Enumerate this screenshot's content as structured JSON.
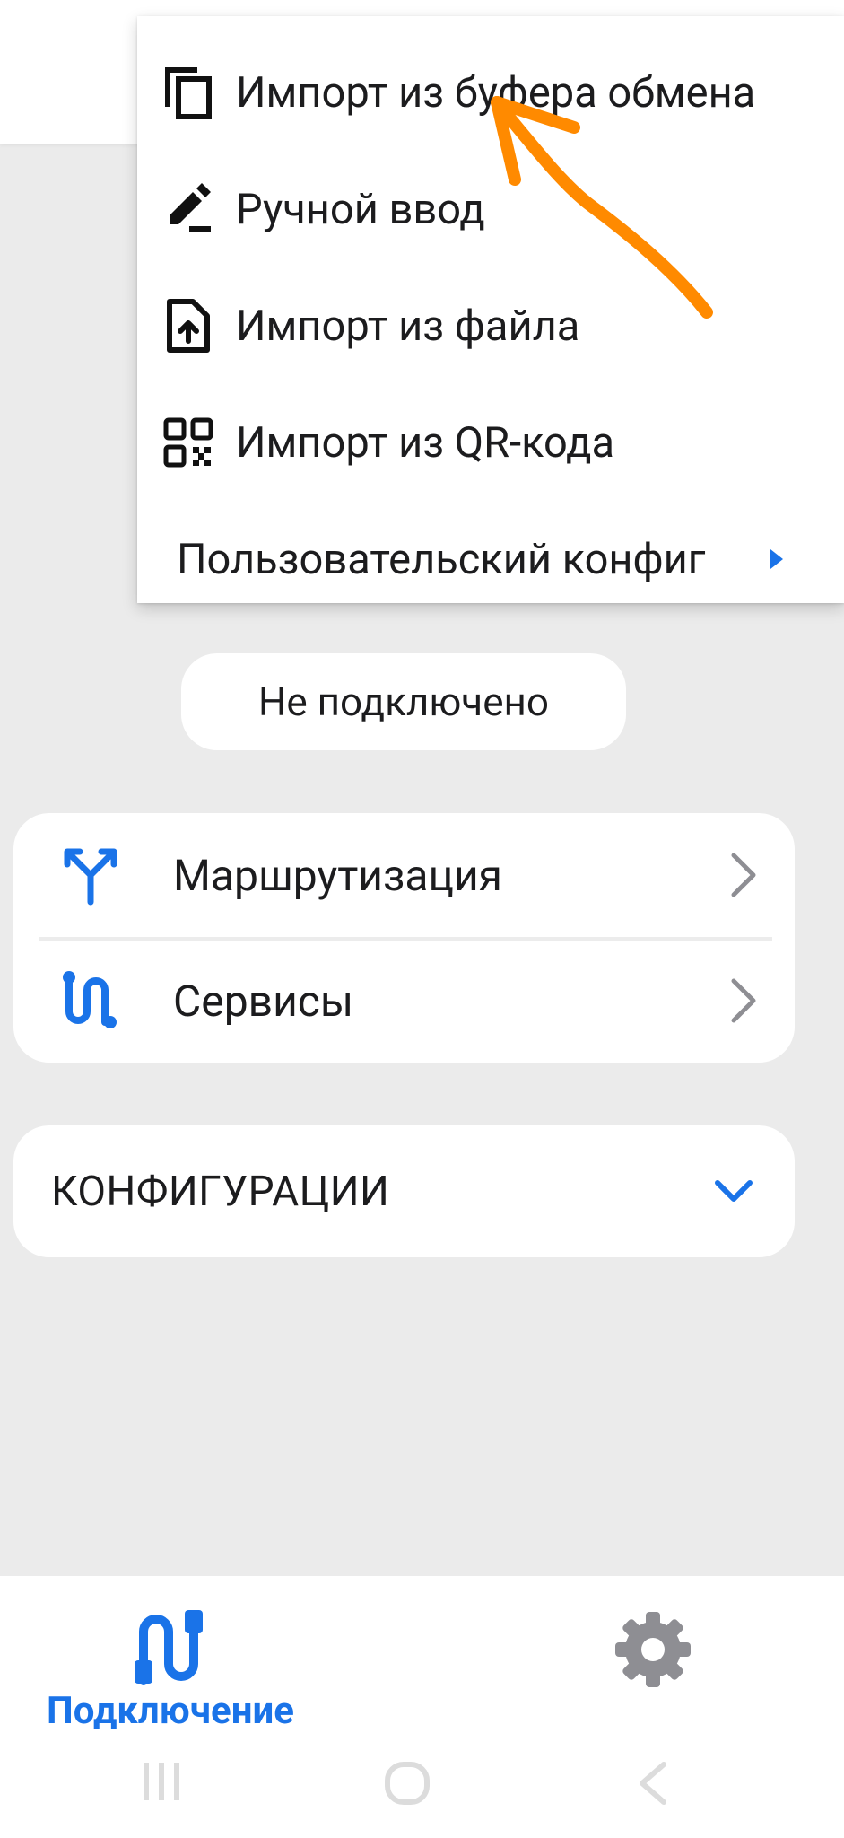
{
  "colors": {
    "accent": "#1a73e8",
    "background": "#ebebeb",
    "surface": "#ffffff",
    "annotation": "#ff8a00"
  },
  "menu": {
    "items": [
      {
        "label": "Импорт из буфера обмена",
        "icon": "copy-icon"
      },
      {
        "label": "Ручной ввод",
        "icon": "edit-pen-icon"
      },
      {
        "label": "Импорт из файла",
        "icon": "file-upload-icon"
      },
      {
        "label": "Импорт из QR-кода",
        "icon": "qr-code-icon"
      },
      {
        "label": "Пользовательский конфиг",
        "icon": "submenu-arrow-icon"
      }
    ]
  },
  "status": {
    "text": "Не подключено"
  },
  "nav": {
    "items": [
      {
        "label": "Маршрутизация",
        "icon": "routing-icon"
      },
      {
        "label": "Сервисы",
        "icon": "services-icon"
      }
    ]
  },
  "configs": {
    "label": "КОНФИГУРАЦИИ",
    "icon": "chevron-down-icon"
  },
  "bottom_nav": {
    "connect_label": "Подключение",
    "connect_icon": "connection-icon",
    "settings_icon": "gear-icon"
  },
  "system_nav": {
    "recents_icon": "recents-icon",
    "home_icon": "home-icon",
    "back_icon": "back-icon"
  }
}
